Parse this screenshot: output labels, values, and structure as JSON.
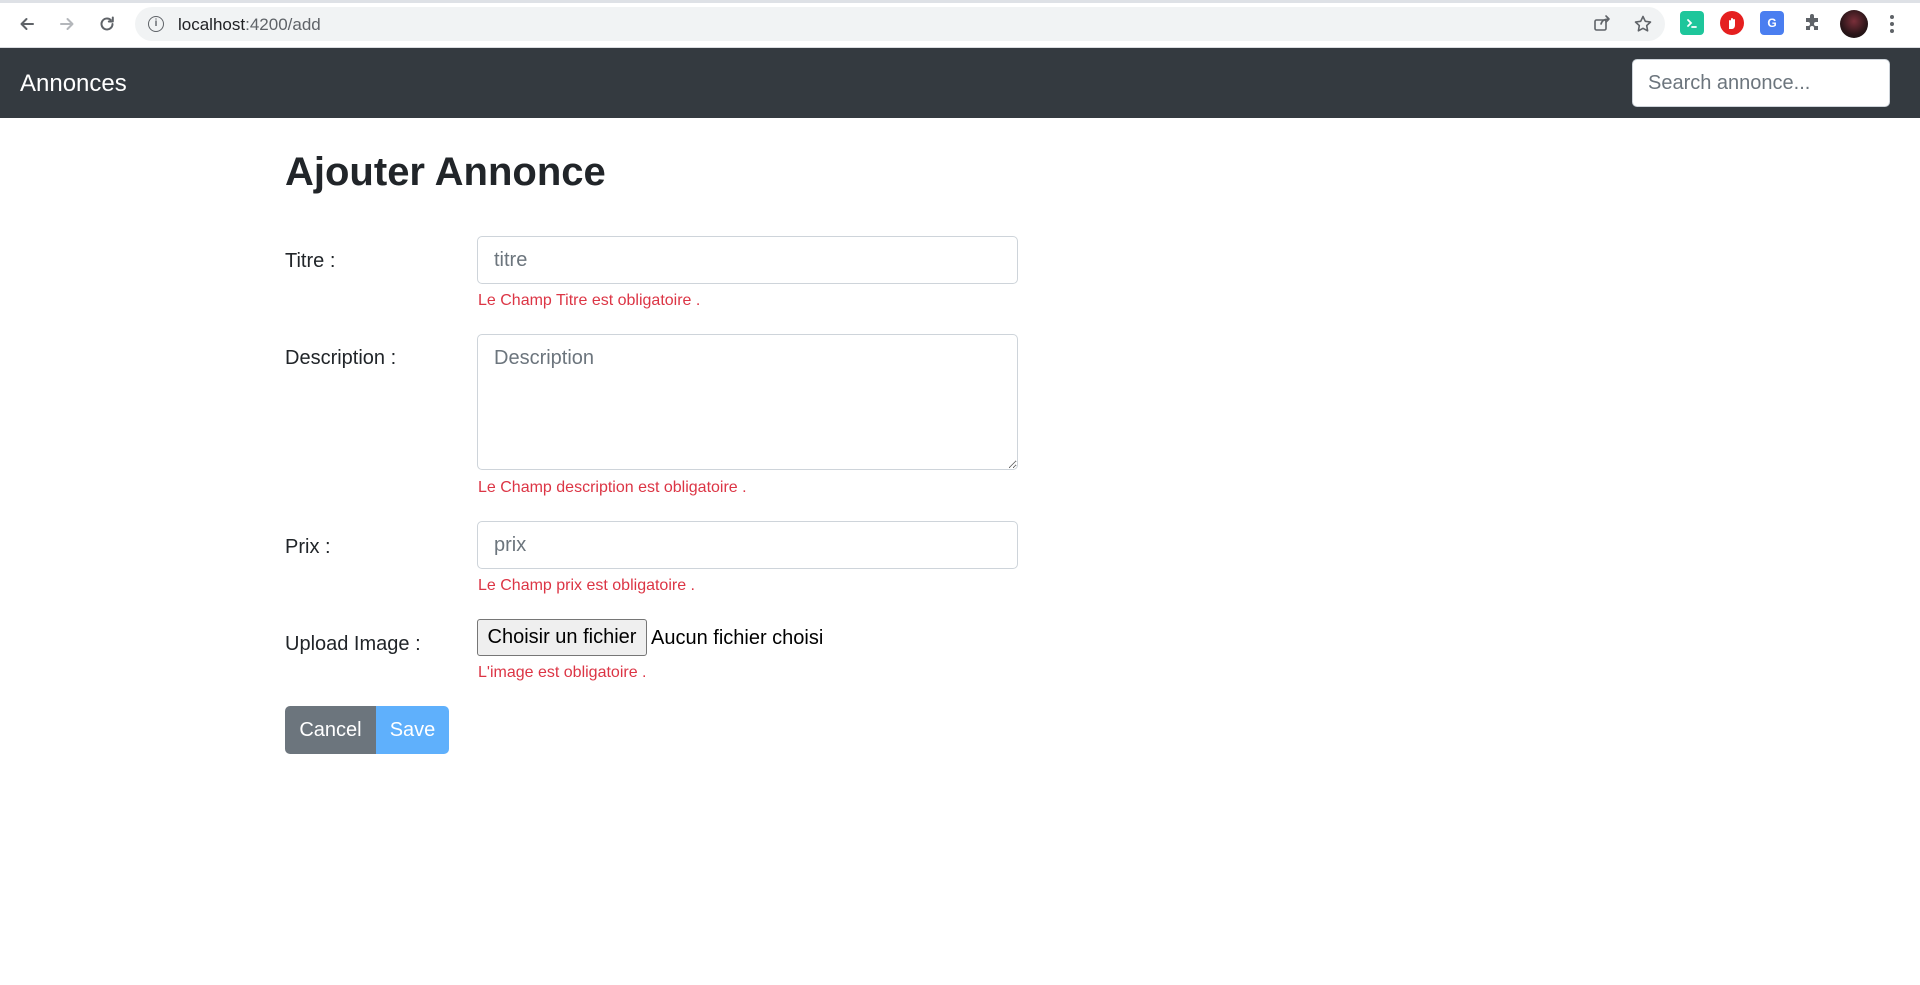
{
  "browser": {
    "url_host": "localhost",
    "url_path": ":4200/add",
    "icons": {
      "back": "arrow-left-icon",
      "forward": "arrow-right-icon",
      "reload": "reload-icon",
      "info": "info-icon",
      "share": "share-icon",
      "bookmark": "star-icon",
      "extensions": "puzzle-icon",
      "menu": "kebab-menu-icon"
    },
    "extension_colors": [
      "#1ec69b",
      "#e51f1f",
      "#4a7ef0",
      "#5f6368"
    ]
  },
  "navbar": {
    "brand": "Annonces",
    "search_placeholder": "Search annonce...",
    "background": "#343a40"
  },
  "page": {
    "title": "Ajouter Annonce"
  },
  "form": {
    "titre": {
      "label": "Titre :",
      "placeholder": "titre",
      "error": "Le Champ Titre est obligatoire ."
    },
    "description": {
      "label": "Description :",
      "placeholder": "Description",
      "error": "Le Champ description est obligatoire ."
    },
    "prix": {
      "label": "Prix :",
      "placeholder": "prix",
      "error": "Le Champ prix est obligatoire ."
    },
    "image": {
      "label": "Upload Image :",
      "button": "Choisir un fichier",
      "status": "Aucun fichier choisi",
      "error": "L'image est obligatoire ."
    },
    "actions": {
      "cancel": "Cancel",
      "save": "Save"
    },
    "colors": {
      "error": "#dc3545",
      "cancel": "#6c757d",
      "save": "#5fb0fc"
    }
  }
}
